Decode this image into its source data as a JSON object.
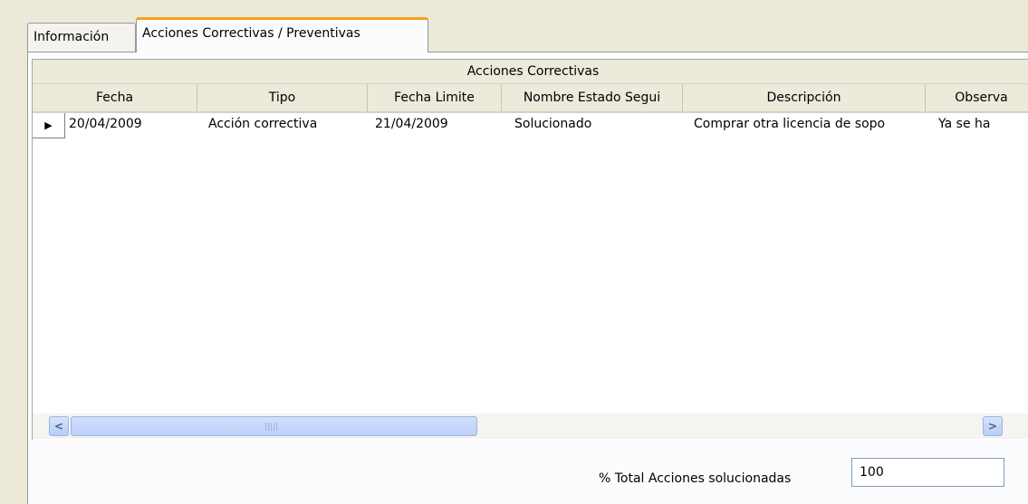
{
  "tabs": [
    {
      "label": "Información"
    },
    {
      "label": "Acciones Correctivas / Preventivas"
    }
  ],
  "grid": {
    "caption": "Acciones Correctivas",
    "columns": [
      "Fecha",
      "Tipo",
      "Fecha Limite",
      "Nombre Estado Segui",
      "Descripción",
      "Observa"
    ],
    "rows": [
      {
        "selector": "▶",
        "fecha": "20/04/2009",
        "tipo": "Acción correctiva",
        "fecha_limite": "21/04/2009",
        "estado": "Solucionado",
        "descripcion": "Comprar otra licencia de sopo",
        "observaciones": "Ya se ha"
      }
    ]
  },
  "scrollbar": {
    "left": "<",
    "right": ">"
  },
  "total": {
    "label": "% Total Acciones solucionadas",
    "value": "100"
  }
}
